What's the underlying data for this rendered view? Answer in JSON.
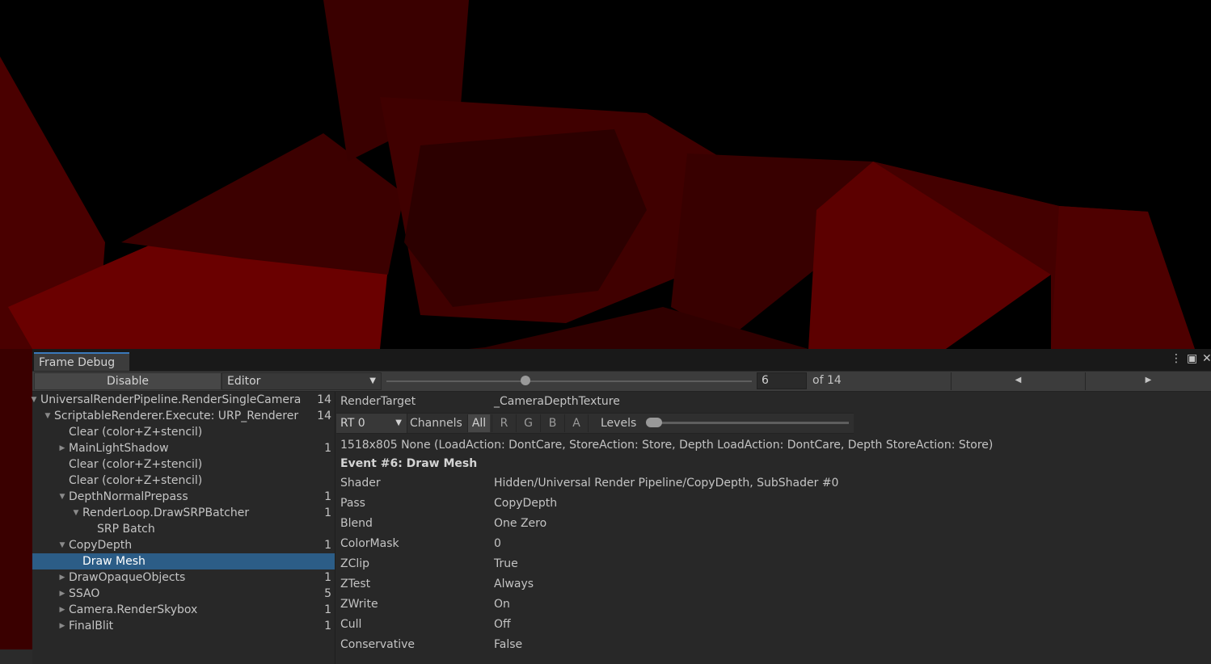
{
  "window": {
    "tab_title": "Frame Debug",
    "menu_icon": "kebab-menu-icon",
    "maximize_icon": "maximize-icon",
    "close_icon": "close-icon"
  },
  "toolbar": {
    "disable_label": "Disable",
    "target_dropdown": "Editor",
    "slider_value_fraction": 0.38,
    "event_index": "6",
    "event_total": "of 14",
    "prev_icon": "triangle-left-icon",
    "next_icon": "triangle-right-icon"
  },
  "tree": [
    {
      "label": "UniversalRenderPipeline.RenderSingleCamera",
      "count": "14",
      "expanded": true
    },
    {
      "label": "ScriptableRenderer.Execute: URP_Renderer",
      "count": "14",
      "expanded": true
    },
    {
      "label": "Clear (color+Z+stencil)",
      "count": ""
    },
    {
      "label": "MainLightShadow",
      "count": "1",
      "expanded": false
    },
    {
      "label": "Clear (color+Z+stencil)",
      "count": ""
    },
    {
      "label": "Clear (color+Z+stencil)",
      "count": ""
    },
    {
      "label": "DepthNormalPrepass",
      "count": "1",
      "expanded": true
    },
    {
      "label": "RenderLoop.DrawSRPBatcher",
      "count": "1",
      "expanded": true
    },
    {
      "label": "SRP Batch",
      "count": ""
    },
    {
      "label": "CopyDepth",
      "count": "1",
      "expanded": true
    },
    {
      "label": "Draw Mesh",
      "count": "",
      "selected": true
    },
    {
      "label": "DrawOpaqueObjects",
      "count": "1",
      "expanded": false
    },
    {
      "label": "SSAO",
      "count": "5",
      "expanded": false
    },
    {
      "label": "Camera.RenderSkybox",
      "count": "1",
      "expanded": false
    },
    {
      "label": "FinalBlit",
      "count": "1",
      "expanded": false
    }
  ],
  "details": {
    "render_target_label": "RenderTarget",
    "render_target_value": "_CameraDepthTexture",
    "rt_dropdown": "RT 0",
    "channels_label": "Channels",
    "channels": [
      "All",
      "R",
      "G",
      "B",
      "A"
    ],
    "active_channel": "All",
    "levels_label": "Levels",
    "target_info": "1518x805 None (LoadAction: DontCare, StoreAction: Store, Depth LoadAction: DontCare, Depth StoreAction: Store)",
    "event_title": "Event #6: Draw Mesh",
    "properties": [
      {
        "name": "Shader",
        "value": "Hidden/Universal Render Pipeline/CopyDepth, SubShader #0"
      },
      {
        "name": "Pass",
        "value": "CopyDepth"
      },
      {
        "name": "Blend",
        "value": "One Zero"
      },
      {
        "name": "ColorMask",
        "value": "0"
      },
      {
        "name": "ZClip",
        "value": "True"
      },
      {
        "name": "ZTest",
        "value": "Always"
      },
      {
        "name": "ZWrite",
        "value": "On"
      },
      {
        "name": "Cull",
        "value": "Off"
      },
      {
        "name": "Conservative",
        "value": "False"
      }
    ]
  },
  "colors": {
    "selection": "#2c5d87",
    "accent": "#3a79bb",
    "viewport_red": "#5a0000"
  }
}
